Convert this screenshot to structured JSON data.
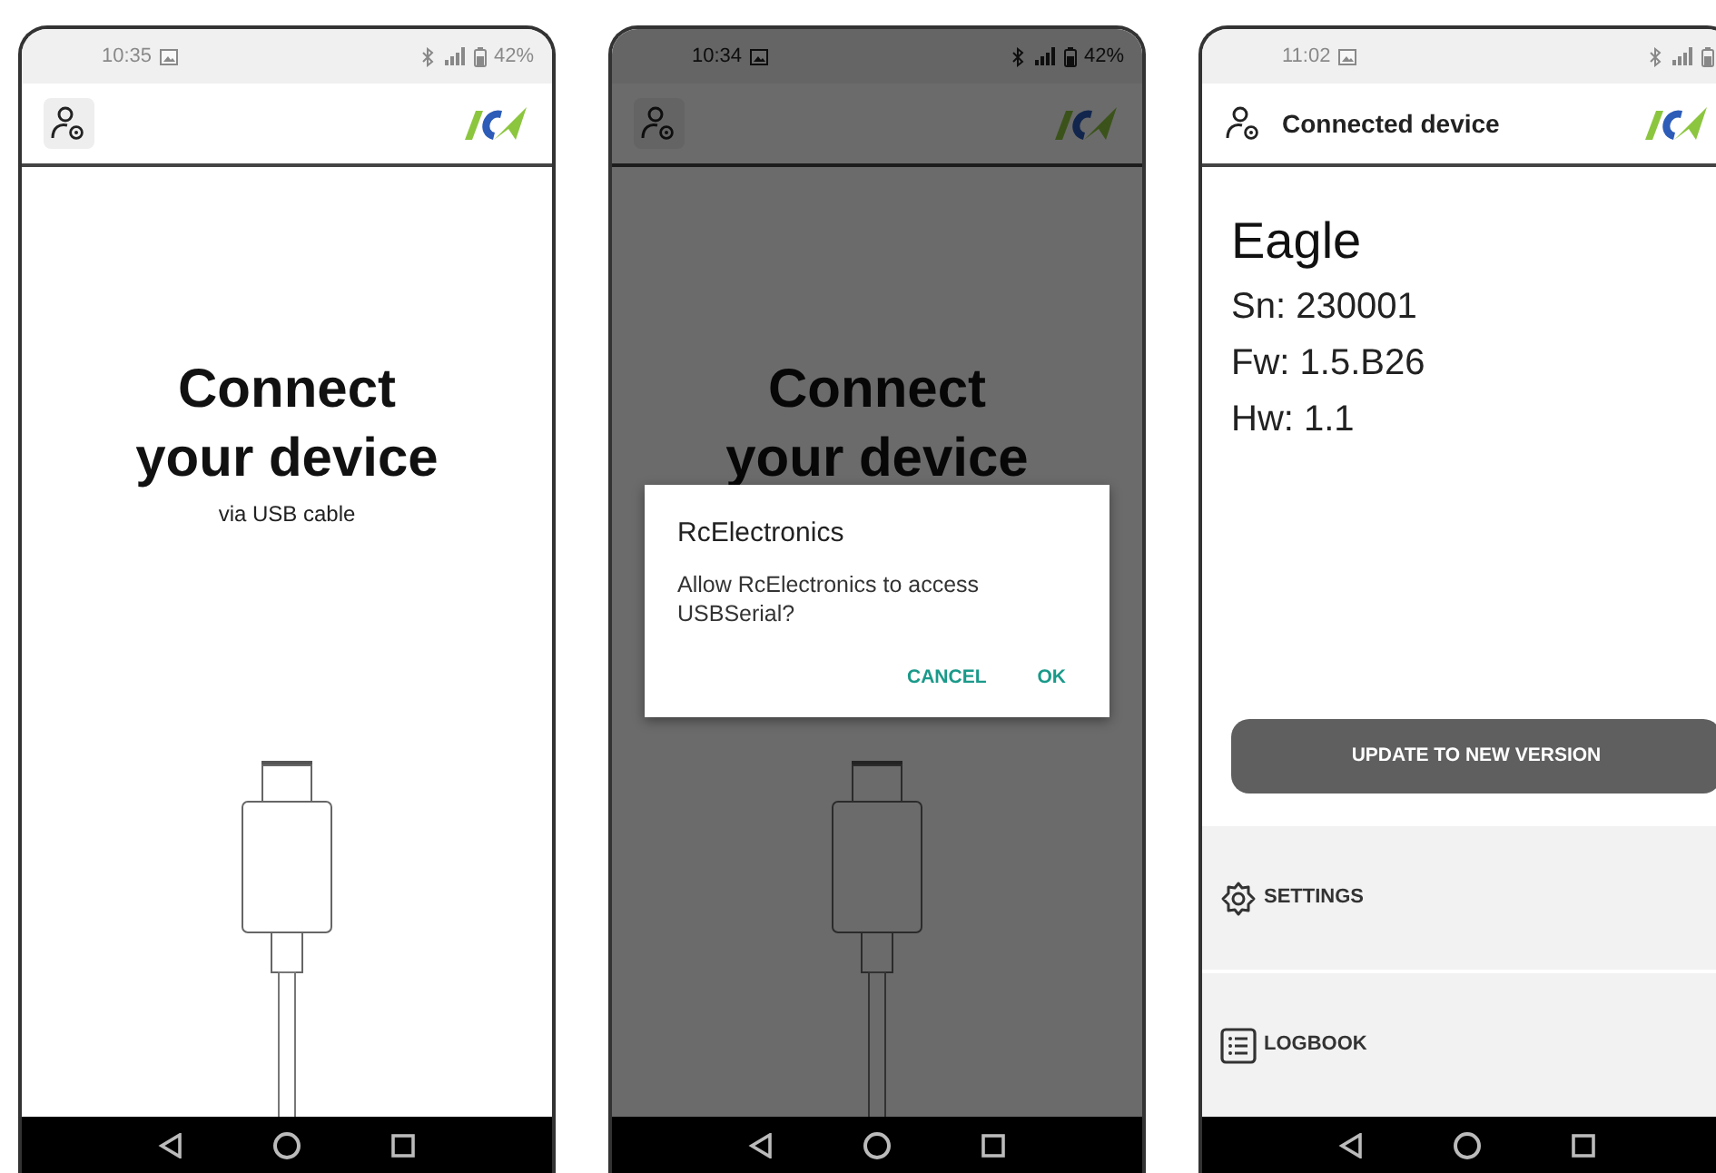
{
  "screens": [
    {
      "kind": "connect",
      "status_bar": {
        "time": "10:35",
        "battery": "42%",
        "faded": true
      },
      "heading": "Connect your device",
      "subheading": "via USB cable"
    },
    {
      "kind": "connect",
      "status_bar": {
        "time": "10:34",
        "battery": "42%",
        "faded": false
      },
      "heading": "Connect your device",
      "dialog": {
        "title": "RcElectronics",
        "message": "Allow RcElectronics to access USBSerial?",
        "buttons": [
          "CANCEL",
          "OK"
        ]
      }
    },
    {
      "kind": "device",
      "status_bar": {
        "time": "11:02",
        "faded": true
      },
      "app_bar": {
        "title": "Connected device"
      },
      "device": {
        "name": "Eagle",
        "details": [
          "Sn: 230001",
          "Fw: 1.5.B26",
          "Hw: 1.1"
        ]
      },
      "action_button": "UPDATE TO NEW VERSION",
      "menu": [
        {
          "kind": "settings",
          "label": "SETTINGS"
        },
        {
          "kind": "logbook",
          "label": "LOGBOOK"
        }
      ]
    }
  ]
}
